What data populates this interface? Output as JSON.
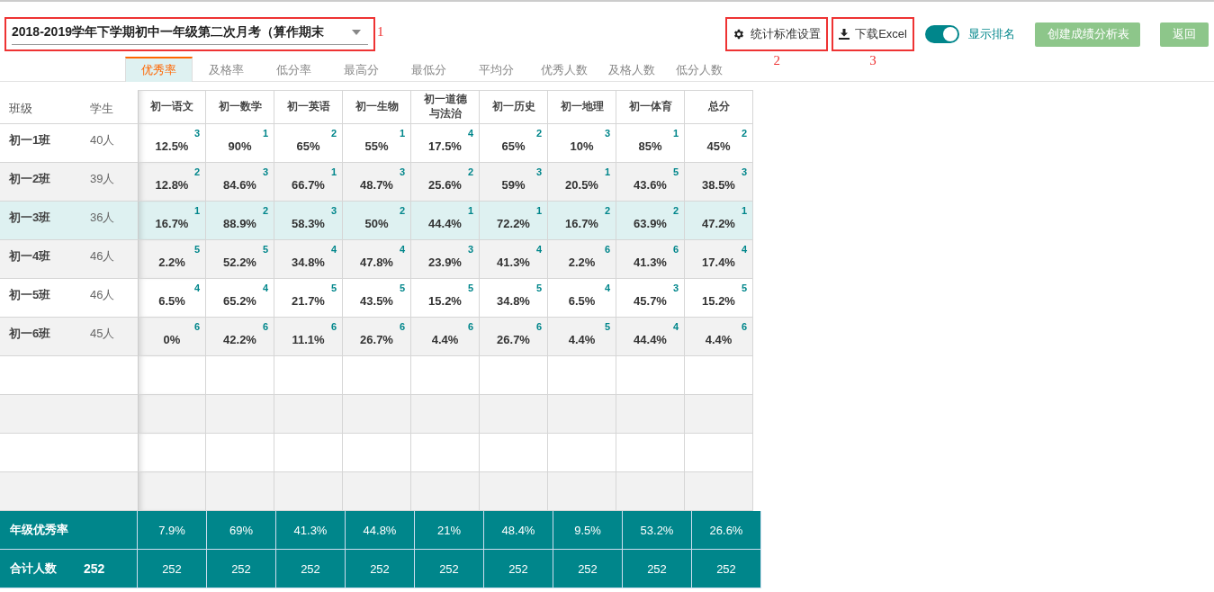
{
  "exam_select": {
    "value": "2018-2019学年下学期初中一年级第二次月考（算作期末",
    "annotation": "1"
  },
  "toolbar": {
    "settings_button": {
      "label": "统计标准设置",
      "annotation": "2"
    },
    "download_button": {
      "label": "下载Excel",
      "annotation": "3"
    },
    "rank_toggle": {
      "label": "显示排名",
      "on": true
    },
    "buttons": [
      "创建成绩分析表",
      "返回"
    ]
  },
  "tabs": [
    {
      "label": "优秀率",
      "selected": true
    },
    {
      "label": "及格率",
      "selected": false
    },
    {
      "label": "低分率",
      "selected": false
    },
    {
      "label": "最高分",
      "selected": false
    },
    {
      "label": "最低分",
      "selected": false
    },
    {
      "label": "平均分",
      "selected": false
    },
    {
      "label": "优秀人数",
      "selected": false
    },
    {
      "label": "及格人数",
      "selected": false
    },
    {
      "label": "低分人数",
      "selected": false
    }
  ],
  "table": {
    "columns": [
      "班级",
      "学生"
    ],
    "subjects": [
      "初一语文",
      "初一数学",
      "初一英语",
      "初一生物",
      "初一道德与法治",
      "初一历史",
      "初一地理",
      "初一体育",
      "总分"
    ],
    "rows": [
      {
        "class": "初一1班",
        "students": "40人",
        "selected": false,
        "cells": [
          {
            "value": "12.5%",
            "rank": "3"
          },
          {
            "value": "90%",
            "rank": "1"
          },
          {
            "value": "65%",
            "rank": "2"
          },
          {
            "value": "55%",
            "rank": "1"
          },
          {
            "value": "17.5%",
            "rank": "4"
          },
          {
            "value": "65%",
            "rank": "2"
          },
          {
            "value": "10%",
            "rank": "3"
          },
          {
            "value": "85%",
            "rank": "1"
          },
          {
            "value": "45%",
            "rank": "2"
          }
        ]
      },
      {
        "class": "初一2班",
        "students": "39人",
        "selected": false,
        "cells": [
          {
            "value": "12.8%",
            "rank": "2"
          },
          {
            "value": "84.6%",
            "rank": "3"
          },
          {
            "value": "66.7%",
            "rank": "1"
          },
          {
            "value": "48.7%",
            "rank": "3"
          },
          {
            "value": "25.6%",
            "rank": "2"
          },
          {
            "value": "59%",
            "rank": "3"
          },
          {
            "value": "20.5%",
            "rank": "1"
          },
          {
            "value": "43.6%",
            "rank": "5"
          },
          {
            "value": "38.5%",
            "rank": "3"
          }
        ]
      },
      {
        "class": "初一3班",
        "students": "36人",
        "selected": true,
        "cells": [
          {
            "value": "16.7%",
            "rank": "1"
          },
          {
            "value": "88.9%",
            "rank": "2"
          },
          {
            "value": "58.3%",
            "rank": "3"
          },
          {
            "value": "50%",
            "rank": "2"
          },
          {
            "value": "44.4%",
            "rank": "1"
          },
          {
            "value": "72.2%",
            "rank": "1"
          },
          {
            "value": "16.7%",
            "rank": "2"
          },
          {
            "value": "63.9%",
            "rank": "2"
          },
          {
            "value": "47.2%",
            "rank": "1"
          }
        ]
      },
      {
        "class": "初一4班",
        "students": "46人",
        "selected": false,
        "cells": [
          {
            "value": "2.2%",
            "rank": "5"
          },
          {
            "value": "52.2%",
            "rank": "5"
          },
          {
            "value": "34.8%",
            "rank": "4"
          },
          {
            "value": "47.8%",
            "rank": "4"
          },
          {
            "value": "23.9%",
            "rank": "3"
          },
          {
            "value": "41.3%",
            "rank": "4"
          },
          {
            "value": "2.2%",
            "rank": "6"
          },
          {
            "value": "41.3%",
            "rank": "6"
          },
          {
            "value": "17.4%",
            "rank": "4"
          }
        ]
      },
      {
        "class": "初一5班",
        "students": "46人",
        "selected": false,
        "cells": [
          {
            "value": "6.5%",
            "rank": "4"
          },
          {
            "value": "65.2%",
            "rank": "4"
          },
          {
            "value": "21.7%",
            "rank": "5"
          },
          {
            "value": "43.5%",
            "rank": "5"
          },
          {
            "value": "15.2%",
            "rank": "5"
          },
          {
            "value": "34.8%",
            "rank": "5"
          },
          {
            "value": "6.5%",
            "rank": "4"
          },
          {
            "value": "45.7%",
            "rank": "3"
          },
          {
            "value": "15.2%",
            "rank": "5"
          }
        ]
      },
      {
        "class": "初一6班",
        "students": "45人",
        "selected": false,
        "cells": [
          {
            "value": "0%",
            "rank": "6"
          },
          {
            "value": "42.2%",
            "rank": "6"
          },
          {
            "value": "11.1%",
            "rank": "6"
          },
          {
            "value": "26.7%",
            "rank": "6"
          },
          {
            "value": "4.4%",
            "rank": "6"
          },
          {
            "value": "26.7%",
            "rank": "6"
          },
          {
            "value": "4.4%",
            "rank": "5"
          },
          {
            "value": "44.4%",
            "rank": "4"
          },
          {
            "value": "4.4%",
            "rank": "6"
          }
        ]
      }
    ],
    "footer": [
      {
        "label": "年级优秀率",
        "values": [
          "7.9%",
          "69%",
          "41.3%",
          "44.8%",
          "21%",
          "48.4%",
          "9.5%",
          "53.2%",
          "26.6%"
        ]
      },
      {
        "label": "合计人数",
        "total": "252",
        "values": [
          "252",
          "252",
          "252",
          "252",
          "252",
          "252",
          "252",
          "252",
          "252"
        ]
      }
    ]
  }
}
